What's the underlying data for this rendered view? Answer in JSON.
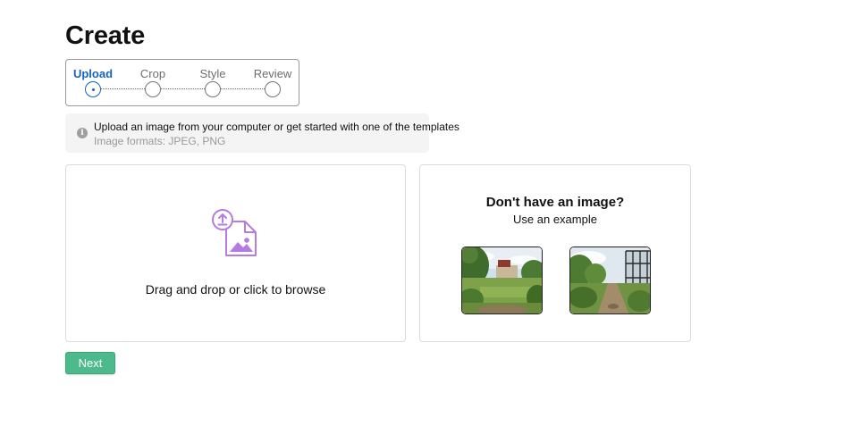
{
  "page": {
    "title": "Create"
  },
  "stepper": {
    "steps": [
      {
        "label": "Upload",
        "active": true
      },
      {
        "label": "Crop",
        "active": false
      },
      {
        "label": "Style",
        "active": false
      },
      {
        "label": "Review",
        "active": false
      }
    ]
  },
  "info": {
    "icon": "info-icon",
    "message": "Upload an image from your computer or get started with one of the templates",
    "formats": "Image formats: JPEG, PNG"
  },
  "upload": {
    "icon": "file-upload-icon",
    "label": "Drag and drop or click to browse"
  },
  "examples": {
    "title": "Don't have an image?",
    "subtitle": "Use an example",
    "thumbnails": [
      "garden-lawn-example",
      "garden-path-greenhouse-example"
    ]
  },
  "actions": {
    "next_label": "Next"
  },
  "colors": {
    "accent_blue": "#1565c0",
    "upload_icon_purple": "#b57be0",
    "next_green": "#4cba8c"
  }
}
